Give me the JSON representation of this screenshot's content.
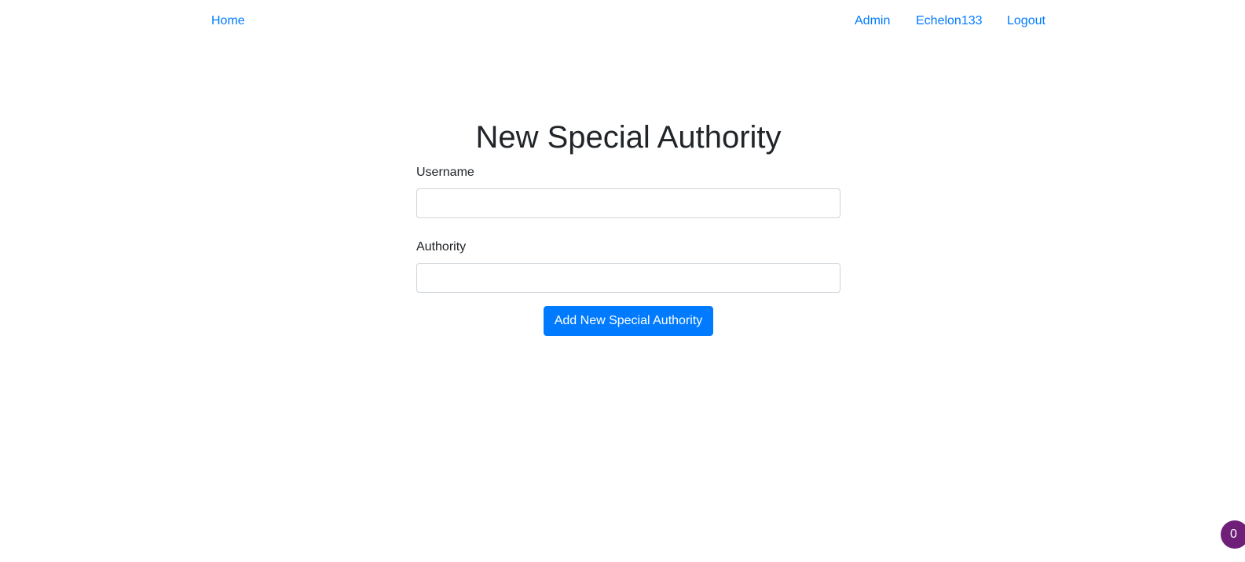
{
  "nav": {
    "home": "Home",
    "admin": "Admin",
    "user": "Echelon133",
    "logout": "Logout"
  },
  "main": {
    "title": "New Special Authority",
    "username_label": "Username",
    "username_value": "",
    "authority_label": "Authority",
    "authority_value": "",
    "submit_label": "Add New Special Authority"
  },
  "badge": {
    "count": "0"
  },
  "colors": {
    "link": "#007bff",
    "primary_button": "#007bff",
    "badge": "#6f1f78",
    "text": "#212529"
  }
}
